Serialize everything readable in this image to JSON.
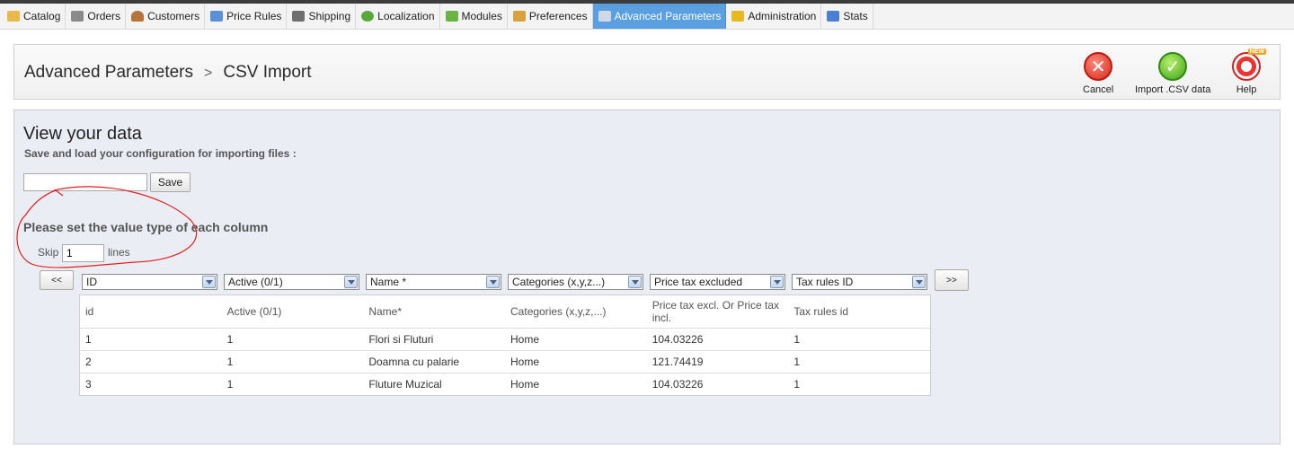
{
  "menu": {
    "tabs": [
      {
        "label": "Catalog",
        "icon": "folder-icon",
        "color": "#e8b84a"
      },
      {
        "label": "Orders",
        "icon": "cart-icon",
        "color": "#8a8a8a"
      },
      {
        "label": "Customers",
        "icon": "person-icon",
        "color": "#b5743b"
      },
      {
        "label": "Price Rules",
        "icon": "price-tag-icon",
        "color": "#5b8fd6"
      },
      {
        "label": "Shipping",
        "icon": "truck-icon",
        "color": "#6f6f6f"
      },
      {
        "label": "Localization",
        "icon": "globe-icon",
        "color": "#59a83a"
      },
      {
        "label": "Modules",
        "icon": "puzzle-icon",
        "color": "#6bb344"
      },
      {
        "label": "Preferences",
        "icon": "preferences-icon",
        "color": "#d9a23a"
      },
      {
        "label": "Advanced Parameters",
        "icon": "wrench-icon",
        "color": "#d0d8e6"
      },
      {
        "label": "Administration",
        "icon": "key-icon",
        "color": "#e6b91e"
      },
      {
        "label": "Stats",
        "icon": "bar-chart-icon",
        "color": "#4a7fd1"
      }
    ],
    "active_index": 8
  },
  "toolbar": {
    "breadcrumb_section": "Advanced Parameters",
    "breadcrumb_sep": ">",
    "breadcrumb_page": "CSV Import",
    "cancel_label": "Cancel",
    "import_label": "Import .CSV data",
    "help_label": "Help",
    "help_badge": "NEW"
  },
  "panel": {
    "title": "View your data",
    "subtitle": "Save and load your configuration for importing files :",
    "config_input_value": "",
    "save_label": "Save",
    "column_heading": "Please set the value type of each column",
    "skip_label": "Skip",
    "skip_value": "1",
    "lines_label": "lines",
    "prev_label": "<<",
    "next_label": ">>"
  },
  "columns": [
    {
      "select": "ID",
      "header": "id"
    },
    {
      "select": "Active (0/1)",
      "header": "Active (0/1)"
    },
    {
      "select": "Name *",
      "header": "Name*"
    },
    {
      "select": "Categories (x,y,z...)",
      "header": "Categories (x,y,z,...)"
    },
    {
      "select": "Price tax excluded",
      "header": "Price tax excl. Or Price tax incl."
    },
    {
      "select": "Tax rules ID",
      "header": "Tax rules id"
    }
  ],
  "rows": [
    [
      "1",
      "1",
      "Flori si Fluturi",
      "Home",
      "104.03226",
      "1"
    ],
    [
      "2",
      "1",
      "Doamna cu palarie",
      "Home",
      "121.74419",
      "1"
    ],
    [
      "3",
      "1",
      "Fluture Muzical",
      "Home",
      "104.03226",
      "1"
    ]
  ],
  "colors": {
    "active_tab": "#5a9fe0",
    "panel_bg": "#ebedf4",
    "annotation_red": "#e02020"
  }
}
